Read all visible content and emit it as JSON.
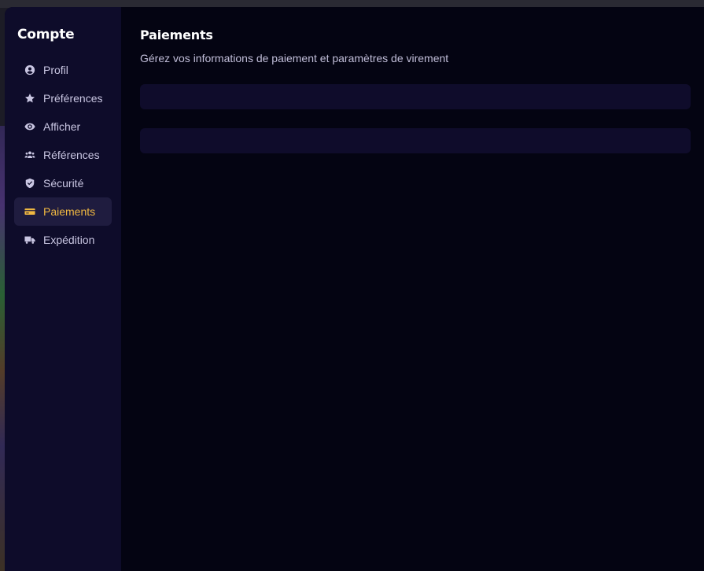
{
  "sidebar": {
    "title": "Compte",
    "items": [
      {
        "label": "Profil",
        "icon": "user-circle-icon"
      },
      {
        "label": "Préférences",
        "icon": "star-icon"
      },
      {
        "label": "Afficher",
        "icon": "eye-icon"
      },
      {
        "label": "Références",
        "icon": "users-icon"
      },
      {
        "label": "Sécurité",
        "icon": "shield-check-icon"
      },
      {
        "label": "Paiements",
        "icon": "credit-card-icon",
        "active": true
      },
      {
        "label": "Expédition",
        "icon": "truck-icon"
      }
    ]
  },
  "main": {
    "title": "Paiements",
    "subtitle": "Gérez vos informations de paiement et paramètres de virement"
  },
  "colors": {
    "accent": "#f1b941",
    "sidebar_bg": "#0e0c2a",
    "content_bg": "#040412",
    "panel_bg": "#0f0c2b"
  }
}
